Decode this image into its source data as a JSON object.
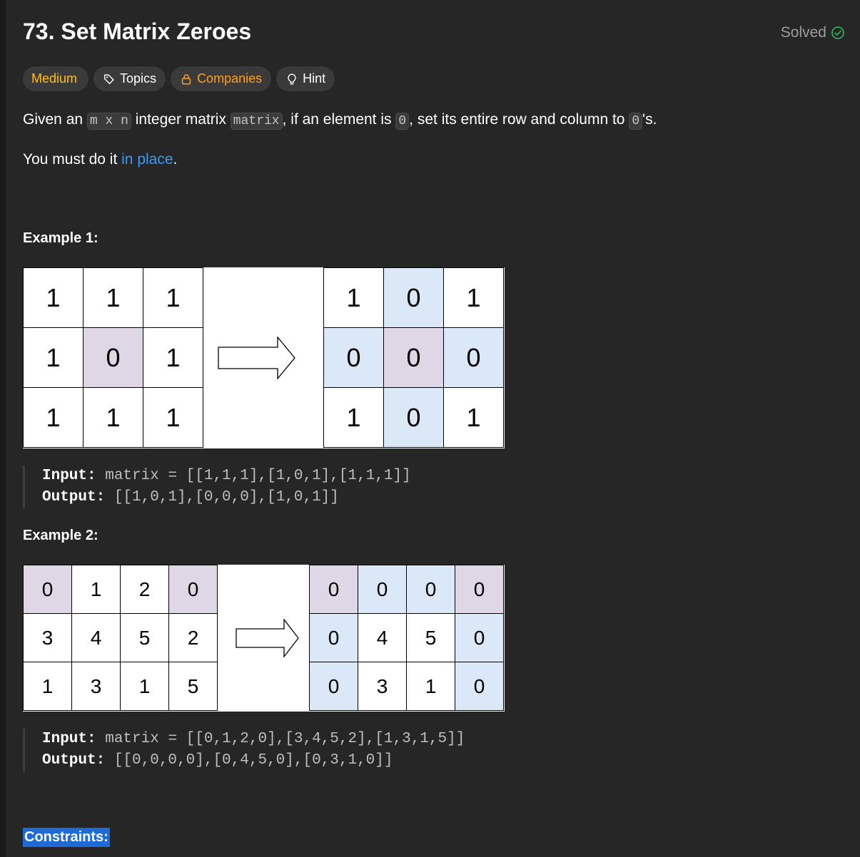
{
  "problem": {
    "title": "73. Set Matrix Zeroes",
    "status": "Solved",
    "status_color": "#2cbb5d"
  },
  "tags": {
    "difficulty": "Medium",
    "topics": "Topics",
    "companies": "Companies",
    "hint": "Hint"
  },
  "description": {
    "p1_a": "Given an ",
    "p1_code1": "m x n",
    "p1_b": " integer matrix ",
    "p1_code2": "matrix",
    "p1_c": ", if an element is ",
    "p1_code3": "0",
    "p1_d": ", set its entire row and column to ",
    "p1_code4": "0",
    "p1_e": "'s.",
    "p2_a": "You must do it ",
    "p2_link": "in place",
    "p2_b": "."
  },
  "example1": {
    "title": "Example 1:",
    "before": [
      [
        "1",
        "1",
        "1"
      ],
      [
        "1",
        "0",
        "1"
      ],
      [
        "1",
        "1",
        "1"
      ]
    ],
    "after": [
      [
        "1",
        "0",
        "1"
      ],
      [
        "0",
        "0",
        "0"
      ],
      [
        "1",
        "0",
        "1"
      ]
    ],
    "input_label": "Input:",
    "input_text": " matrix = [[1,1,1],[1,0,1],[1,1,1]]",
    "output_label": "Output:",
    "output_text": " [[1,0,1],[0,0,0],[1,0,1]]"
  },
  "example2": {
    "title": "Example 2:",
    "before": [
      [
        "0",
        "1",
        "2",
        "0"
      ],
      [
        "3",
        "4",
        "5",
        "2"
      ],
      [
        "1",
        "3",
        "1",
        "5"
      ]
    ],
    "after": [
      [
        "0",
        "0",
        "0",
        "0"
      ],
      [
        "0",
        "4",
        "5",
        "0"
      ],
      [
        "0",
        "3",
        "1",
        "0"
      ]
    ],
    "input_label": "Input:",
    "input_text": " matrix = [[0,1,2,0],[3,4,5,2],[1,3,1,5]]",
    "output_label": "Output:",
    "output_text": " [[0,0,0,0],[0,4,5,0],[0,3,1,0]]"
  },
  "constraints": {
    "title": "Constraints:"
  }
}
